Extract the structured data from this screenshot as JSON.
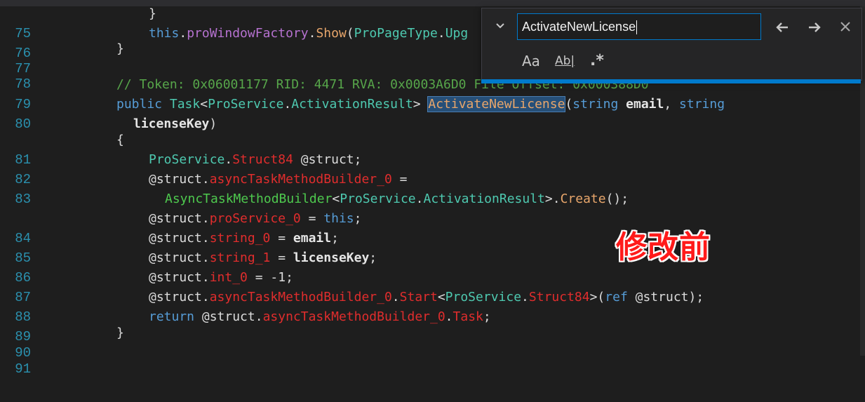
{
  "find_widget": {
    "search_value": "ActivateNewLicense",
    "toggle_icon": "chevron-down-icon",
    "prev_icon": "arrow-left-icon",
    "next_icon": "arrow-right-icon",
    "close_icon": "close-icon",
    "match_case_label": "Aa",
    "whole_word_label": "Ab|",
    "regex_label": ".*",
    "accent_color": "#007acc"
  },
  "overlay_label": "修改前",
  "lines": {
    "l75": {
      "num": "75",
      "t1": "}"
    },
    "l76": {
      "num": "76",
      "t1": "this",
      "t2": ".",
      "t3": "proWindowFactory",
      "t4": ".",
      "t5": "Show",
      "t6": "(",
      "t7": "ProPageType",
      "t8": ".",
      "t9": "Upg"
    },
    "l77": {
      "num": "77",
      "t1": "}"
    },
    "l78": {
      "num": "78"
    },
    "l79": {
      "num": "79",
      "t1": "// Token: 0x06001177 RID: 4471 RVA: 0x0003A6D0 File Offset: 0x000388D0"
    },
    "l80": {
      "num": "80",
      "t1": "public",
      "t2": "Task",
      "t3": "<",
      "t4": "ProService",
      "t5": ".",
      "t6": "ActivationResult",
      "t7": ">",
      "t8": "ActivateNewLicense",
      "t9": "(",
      "t10": "string",
      "t11": "email",
      "t12": ", ",
      "t13": "string"
    },
    "l80b": {
      "t1": "licenseKey",
      "t2": ")"
    },
    "l81": {
      "num": "81",
      "t1": "{"
    },
    "l82": {
      "num": "82",
      "t1": "ProService",
      "t2": ".",
      "t3": "Struct84",
      "t4": " @struct;"
    },
    "l83": {
      "num": "83",
      "t1": "@struct.",
      "t2": "asyncTaskMethodBuilder_0",
      "t3": " ="
    },
    "l83b": {
      "t1": "AsyncTaskMethodBuilder",
      "t2": "<",
      "t3": "ProService",
      "t4": ".",
      "t5": "ActivationResult",
      "t6": ">.",
      "t7": "Create",
      "t8": "();"
    },
    "l84": {
      "num": "84",
      "t1": "@struct.",
      "t2": "proService_0",
      "t3": " = ",
      "t4": "this",
      "t5": ";"
    },
    "l85": {
      "num": "85",
      "t1": "@struct.",
      "t2": "string_0",
      "t3": " = ",
      "t4": "email",
      "t5": ";"
    },
    "l86": {
      "num": "86",
      "t1": "@struct.",
      "t2": "string_1",
      "t3": " = ",
      "t4": "licenseKey",
      "t5": ";"
    },
    "l87": {
      "num": "87",
      "t1": "@struct.",
      "t2": "int_0",
      "t3": " = -1;"
    },
    "l88": {
      "num": "88",
      "t1": "@struct.",
      "t2": "asyncTaskMethodBuilder_0",
      "t3": ".",
      "t4": "Start",
      "t5": "<",
      "t6": "ProService",
      "t7": ".",
      "t8": "Struct84",
      "t9": ">(",
      "t10": "ref",
      "t11": " @struct);"
    },
    "l89": {
      "num": "89",
      "t1": "return",
      "t2": " @struct.",
      "t3": "asyncTaskMethodBuilder_0",
      "t4": ".",
      "t5": "Task",
      "t6": ";"
    },
    "l90": {
      "num": "90",
      "t1": "}"
    },
    "l91": {
      "num": "91"
    }
  }
}
